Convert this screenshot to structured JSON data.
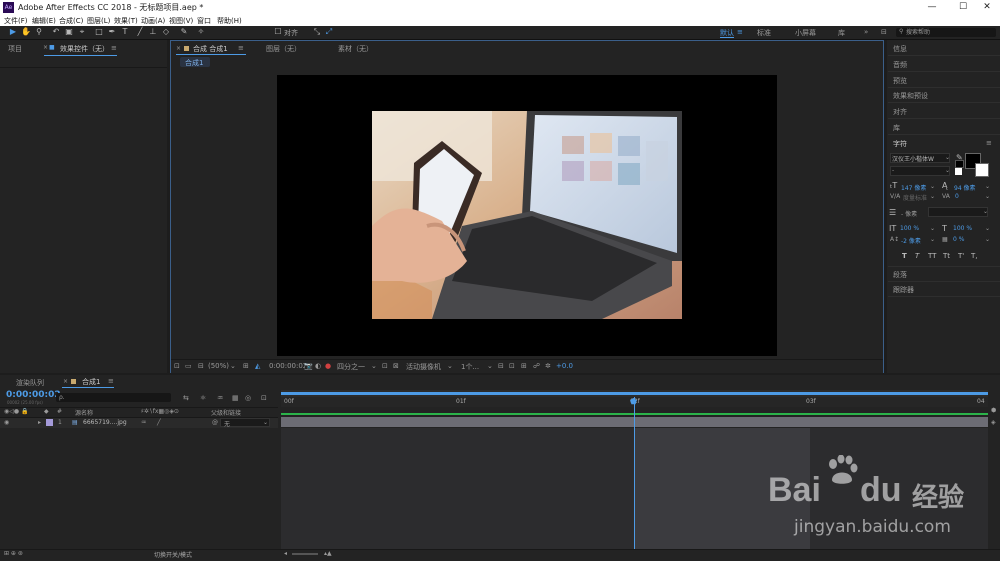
{
  "app": {
    "logo": "Ae",
    "title": "Adobe After Effects CC 2018 - 无标题项目.aep *",
    "window_controls": [
      "—",
      "☐",
      "✕"
    ]
  },
  "menu": [
    "文件(F)",
    "编辑(E)",
    "合成(C)",
    "图层(L)",
    "效果(T)",
    "动画(A)",
    "视图(V)",
    "窗口",
    "帮助(H)"
  ],
  "toolbar": {
    "align_label": "对齐",
    "workspaces": [
      "默认",
      "标准",
      "小屏幕",
      "库"
    ],
    "search_placeholder": "搜索帮助"
  },
  "left_panel": {
    "tab_project": "项目",
    "tab_effects": "效果控件（无）"
  },
  "comp_panel": {
    "tab_comp": "合成 合成1",
    "tab_layer": "图层（无）",
    "tab_footage": "素材（无）",
    "breadcrumb": "合成1",
    "footer": {
      "zoom": "(50%)",
      "timecode": "0:00:00:02",
      "resolution": "四分之一",
      "camera": "活动摄像机",
      "views": "1个...",
      "exposure": "+0.0"
    }
  },
  "right_panel": {
    "items_top": [
      "信息",
      "音频",
      "预览",
      "效果和预设",
      "对齐",
      "库"
    ],
    "char_title": "字符",
    "font_name": "汉仪王小楷体W",
    "font_style": "-",
    "size": "147 像素",
    "leading": "94 像素",
    "kerning": "度量标准",
    "tracking": "0",
    "stroke": "- 像素",
    "vscale": "100 %",
    "hscale": "100 %",
    "baseline": "-2 像素",
    "tsume": "0 %",
    "text_styles": [
      "T",
      "T",
      "TT",
      "Tt",
      "T'",
      "T,"
    ],
    "items_bottom": [
      "段落",
      "跟踪器"
    ]
  },
  "timeline": {
    "tab_render": "渲染队列",
    "tab_comp": "合成1",
    "timecode": "0:00:00:02",
    "timecode_sub": "00002 (25.00 fps)",
    "search_placeholder": "ρ.",
    "col_num": "#",
    "col_name": "源名称",
    "col_parent": "父级和链接",
    "layer": {
      "num": "1",
      "name": "6665719....jpg",
      "parent": "无"
    },
    "ruler": [
      "00f",
      "01f",
      "02f",
      "03f",
      "04"
    ],
    "footer_label": "切换开关/模式"
  },
  "watermark": {
    "brand": "Bai",
    "brand2": "du",
    "cn": "经验",
    "url": "jingyan.baidu.com"
  },
  "colors": {
    "accent": "#4d9be6",
    "ae_brand": "#2a0a55",
    "track_green": "#2bb34a",
    "label_purple": "#a49ad9"
  }
}
